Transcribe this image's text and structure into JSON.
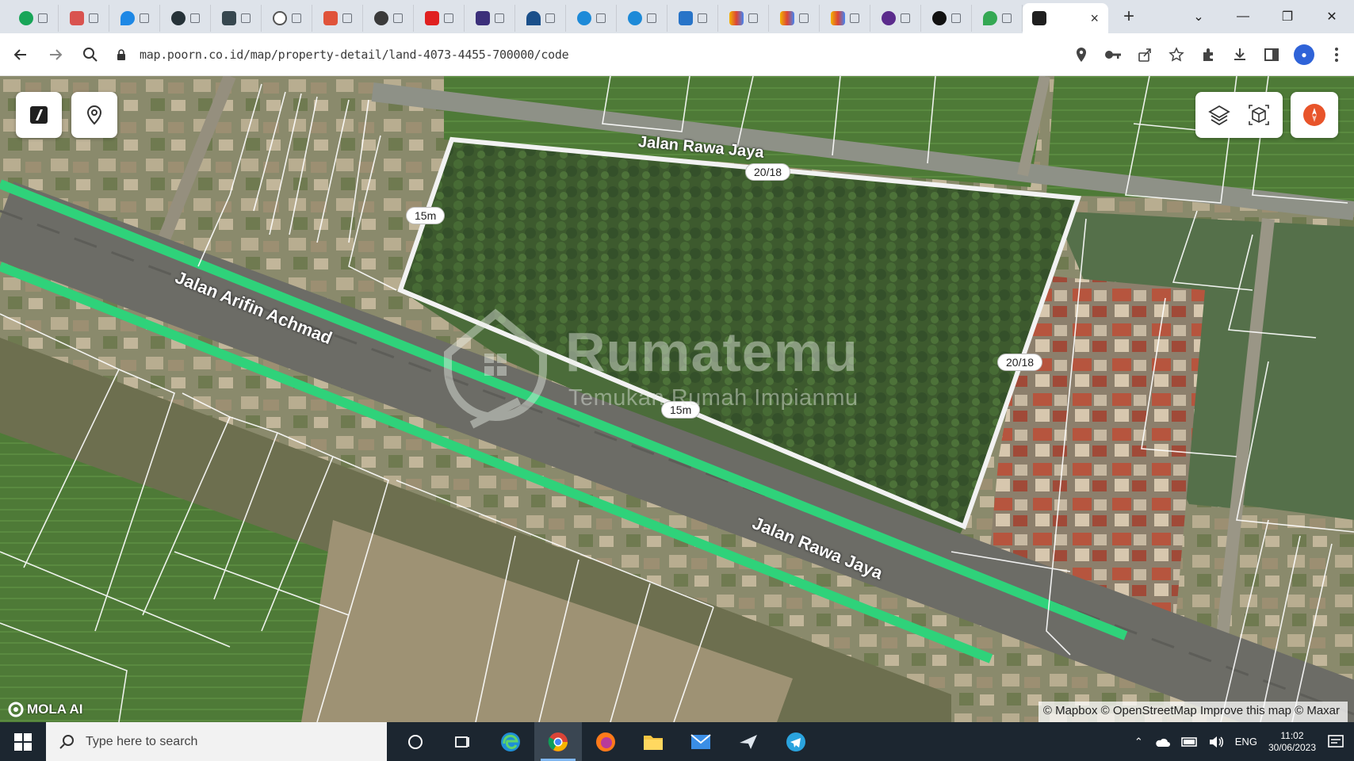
{
  "browser": {
    "active_tab": {
      "title": "",
      "close_label": "×"
    },
    "new_tab_label": "+",
    "tab_count_background": 20,
    "window_controls": [
      "⌄",
      "—",
      "❐",
      "✕"
    ],
    "url": "map.poorn.co.id/map/property-detail/land-4073-4455-700000/code"
  },
  "map": {
    "roads": {
      "north": "Jalan Rawa Jaya",
      "south": "Jalan Rawa Jaya",
      "west": "Jalan Arifin Achmad"
    },
    "dimensions": {
      "top": "20/18",
      "right": "20/18",
      "left": "15m",
      "bottom": "15m"
    },
    "watermark": {
      "title": "Rumatemu",
      "subtitle": "Temukan Rumah Impianmu"
    },
    "controls": {
      "layers_icon": "layers-icon",
      "3d_icon": "cube-3d-icon",
      "compass_icon": "compass-icon",
      "map_icon": "map-logo-icon",
      "pin_icon": "location-pin-icon"
    },
    "attribution": "© Mapbox © OpenStreetMap Improve this map © Maxar",
    "brand": "MOLA AI",
    "colors": {
      "road_highlight": "#2fd27a",
      "boundary": "#ffffff",
      "compass": "#e8542a"
    }
  },
  "taskbar": {
    "search_placeholder": "Type here to search",
    "clock_time": "11:02",
    "clock_date": "30/06/2023",
    "language": "ENG"
  }
}
